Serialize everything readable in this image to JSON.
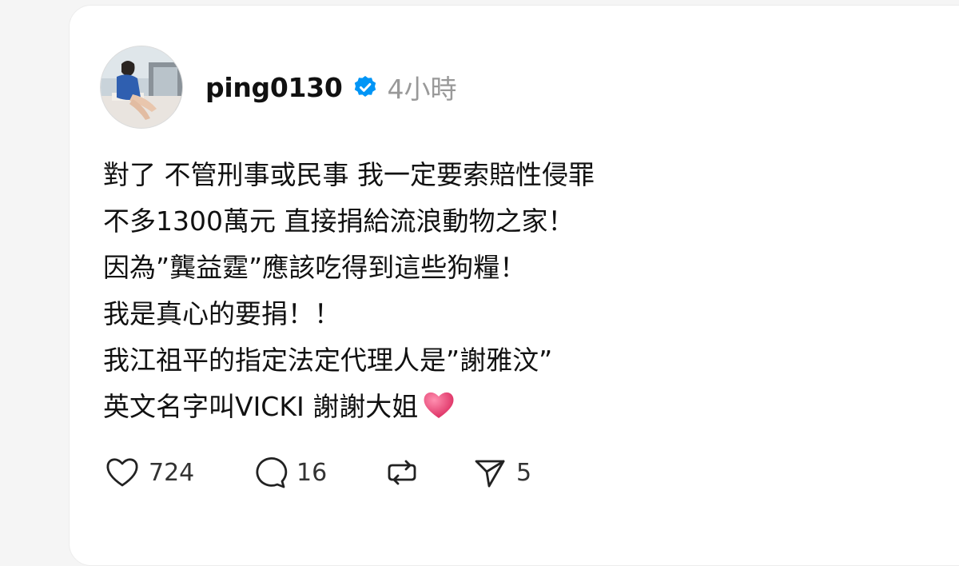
{
  "post": {
    "username": "ping0130",
    "time": "4小時",
    "verified": true,
    "lines": [
      "對了 不管刑事或民事 我一定要索賠性侵罪",
      "不多1300萬元 直接捐給流浪動物之家！",
      "因為”龔益霆”應該吃得到這些狗糧！",
      "我是真心的要捐！！",
      "我江祖平的指定法定代理人是”謝雅汶”",
      "英文名字叫VICKI 謝謝大姐"
    ],
    "emoji": "heart-emoji"
  },
  "actions": {
    "like_count": "724",
    "reply_count": "16",
    "share_count": "5"
  },
  "colors": {
    "verified_blue": "#0095f6",
    "text": "#111111",
    "muted": "#999999",
    "heart_emoji": "#e8456b"
  }
}
